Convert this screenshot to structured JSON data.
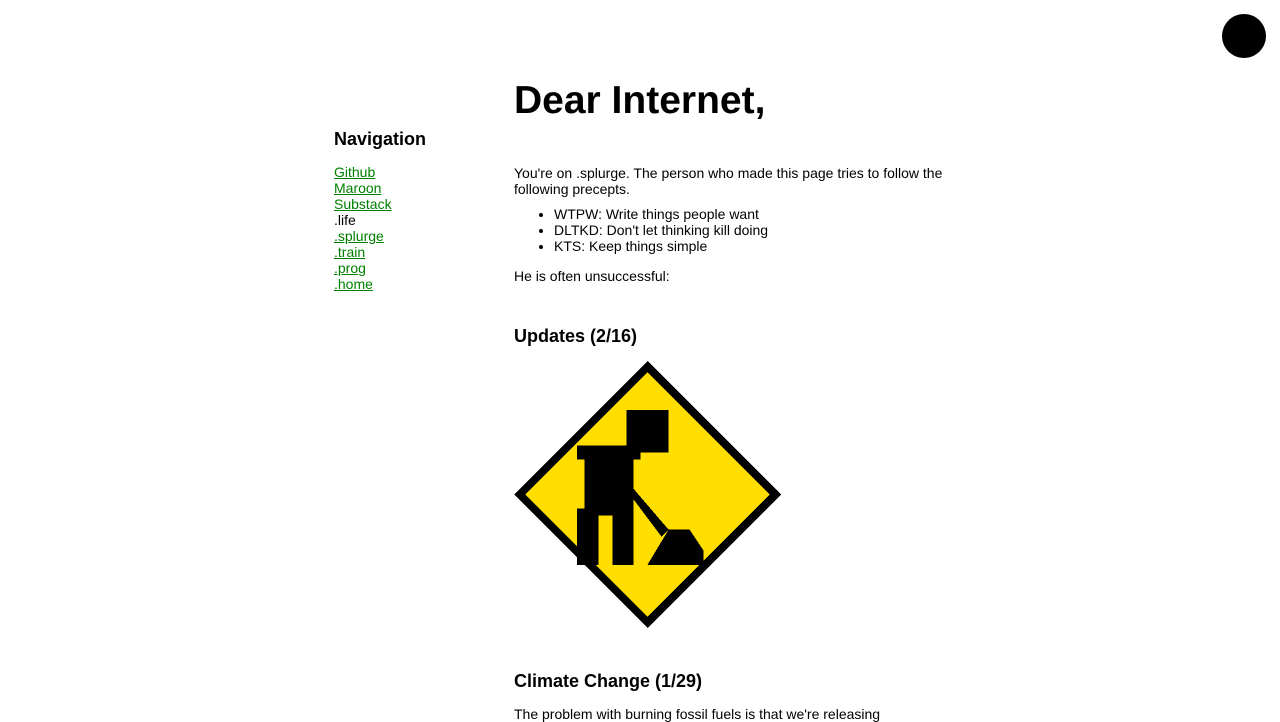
{
  "corner_button": {
    "icon": "circle-icon",
    "color": "#000000"
  },
  "navigation": {
    "heading": "Navigation",
    "items": [
      {
        "label": "Github",
        "link": true
      },
      {
        "label": "Maroon",
        "link": true
      },
      {
        "label": "Substack",
        "link": true
      },
      {
        "label": ".life",
        "link": false
      },
      {
        "label": ".splurge",
        "link": true
      },
      {
        "label": ".train",
        "link": true
      },
      {
        "label": ".prog",
        "link": true
      },
      {
        "label": ".home",
        "link": true
      }
    ],
    "link_color": "#008000"
  },
  "main": {
    "title": "Dear Internet,",
    "intro": "You're on .splurge. The person who made this page tries to follow the following precepts.",
    "precepts": [
      "WTPW: Write things people want",
      "DLTKD: Don't let thinking kill doing",
      "KTS: Keep things simple"
    ],
    "after_list": "He is often unsuccessful:",
    "sections": [
      {
        "heading": "Updates (2/16)",
        "image": "under-construction-sign-icon"
      },
      {
        "heading": "Climate Change (1/29)",
        "text": "The problem with burning fossil fuels is that we're releasing"
      }
    ]
  },
  "colors": {
    "sign_yellow": "#FFDE00",
    "sign_black": "#000000"
  }
}
